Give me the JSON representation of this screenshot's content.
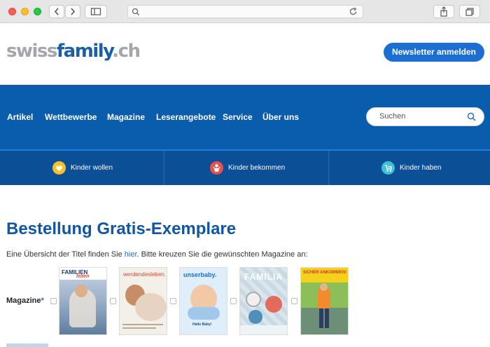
{
  "brand": {
    "logo_part1": "swiss",
    "logo_part2": "family",
    "logo_part3": ".ch",
    "newsletter_label": "Newsletter anmelden"
  },
  "nav": {
    "items": [
      "Artikel",
      "Wettbewerbe",
      "Magazine",
      "Leserangebote",
      "Service",
      "Über uns"
    ],
    "search_placeholder": "Suchen"
  },
  "subnav": {
    "items": [
      "Kinder wollen",
      "Kinder bekommen",
      "Kinder haben"
    ]
  },
  "main": {
    "title": "Bestellung Gratis-Exemplare",
    "intro_before": "Eine Übersicht der Titel finden Sie ",
    "intro_link": "hier",
    "intro_after": ". Bitte kreuzen Sie die gewünschten Magazine an:",
    "magazine_label": "Magazine",
    "required_mark": "*"
  },
  "magazines": [
    {
      "title_line1": "FAMILIEN",
      "title_line2": "leben"
    },
    {
      "title": "werdendesleben."
    },
    {
      "title": "unserbaby.",
      "subtitle": "Hallo Baby!"
    },
    {
      "title": "FAMILIA"
    },
    {
      "title": "SICHER ANKOMMEN!"
    }
  ],
  "colors": {
    "primary": "#0a5cad",
    "accent": "#1b6fd3",
    "title": "#1256a3"
  }
}
